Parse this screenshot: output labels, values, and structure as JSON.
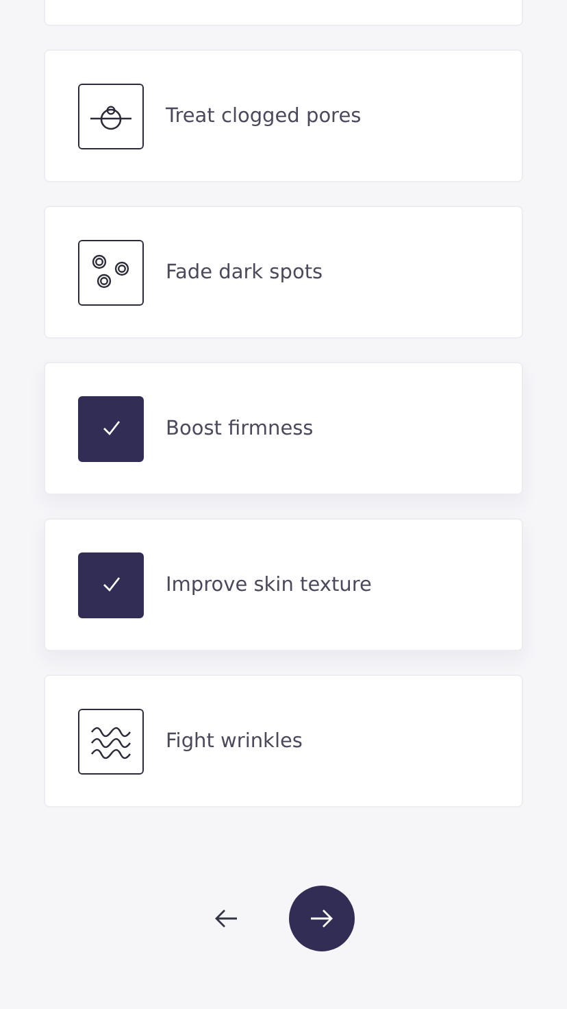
{
  "options": [
    {
      "label": "Treat clogged pores",
      "kind": "pore",
      "checked": false
    },
    {
      "label": "Fade dark spots",
      "kind": "spots",
      "checked": false
    },
    {
      "label": "Boost firmness",
      "checked": true
    },
    {
      "label": "Improve skin texture",
      "checked": true
    },
    {
      "label": "Fight wrinkles",
      "kind": "wrinkles",
      "checked": false
    }
  ]
}
